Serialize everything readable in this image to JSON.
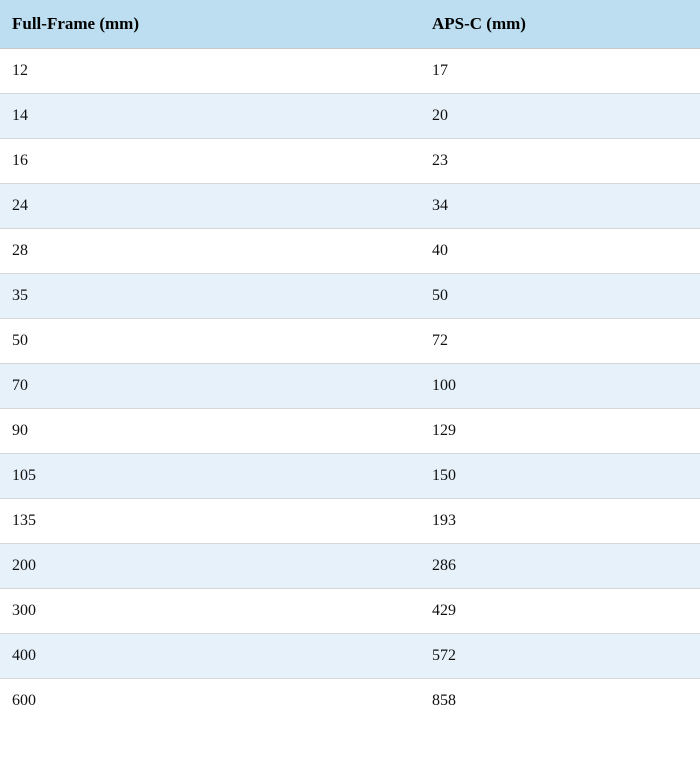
{
  "chart_data": {
    "type": "table",
    "columns": [
      "Full-Frame (mm)",
      "APS-C (mm)"
    ],
    "rows": [
      [
        12,
        17
      ],
      [
        14,
        20
      ],
      [
        16,
        23
      ],
      [
        24,
        34
      ],
      [
        28,
        40
      ],
      [
        35,
        50
      ],
      [
        50,
        72
      ],
      [
        70,
        100
      ],
      [
        90,
        129
      ],
      [
        105,
        150
      ],
      [
        135,
        193
      ],
      [
        200,
        286
      ],
      [
        300,
        429
      ],
      [
        400,
        572
      ],
      [
        600,
        858
      ]
    ]
  },
  "headers": {
    "col1": "Full-Frame (mm)",
    "col2": "APS-C (mm)"
  },
  "rows": [
    {
      "ff": "12",
      "apsc": "17"
    },
    {
      "ff": "14",
      "apsc": "20"
    },
    {
      "ff": "16",
      "apsc": "23"
    },
    {
      "ff": "24",
      "apsc": "34"
    },
    {
      "ff": "28",
      "apsc": "40"
    },
    {
      "ff": "35",
      "apsc": "50"
    },
    {
      "ff": "50",
      "apsc": "72"
    },
    {
      "ff": "70",
      "apsc": "100"
    },
    {
      "ff": "90",
      "apsc": "129"
    },
    {
      "ff": "105",
      "apsc": "150"
    },
    {
      "ff": "135",
      "apsc": "193"
    },
    {
      "ff": "200",
      "apsc": "286"
    },
    {
      "ff": "300",
      "apsc": "429"
    },
    {
      "ff": "400",
      "apsc": "572"
    },
    {
      "ff": "600",
      "apsc": "858"
    }
  ]
}
